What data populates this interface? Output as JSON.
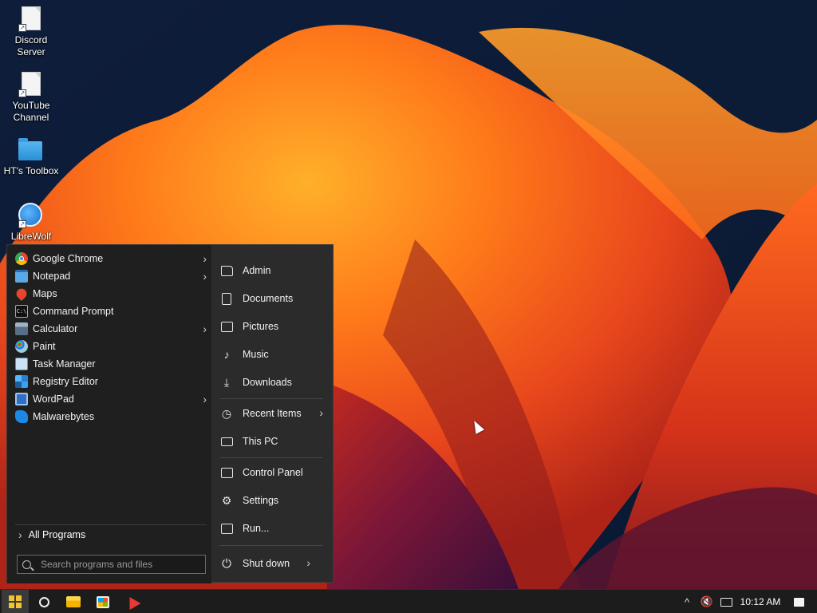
{
  "desktop": {
    "icons": [
      {
        "label_line1": "Discord",
        "label_line2": "Server",
        "icon": "text-file-shortcut-icon"
      },
      {
        "label_line1": "YouTube",
        "label_line2": "Channel",
        "icon": "text-file-shortcut-icon"
      },
      {
        "label_line1": "HT's Toolbox",
        "label_line2": "",
        "icon": "folder-icon"
      },
      {
        "label_line1": "LibreWolf",
        "label_line2": "",
        "icon": "librewolf-icon"
      }
    ]
  },
  "start_menu": {
    "programs": [
      {
        "label": "Google Chrome",
        "icon": "chrome-icon",
        "has_submenu": true
      },
      {
        "label": "Notepad",
        "icon": "notepad-icon",
        "has_submenu": true
      },
      {
        "label": "Maps",
        "icon": "maps-icon",
        "has_submenu": false
      },
      {
        "label": "Command Prompt",
        "icon": "command-prompt-icon",
        "has_submenu": false
      },
      {
        "label": "Calculator",
        "icon": "calculator-icon",
        "has_submenu": true
      },
      {
        "label": "Paint",
        "icon": "paint-icon",
        "has_submenu": false
      },
      {
        "label": "Task Manager",
        "icon": "task-manager-icon",
        "has_submenu": false
      },
      {
        "label": "Registry Editor",
        "icon": "registry-editor-icon",
        "has_submenu": false
      },
      {
        "label": "WordPad",
        "icon": "wordpad-icon",
        "has_submenu": true
      },
      {
        "label": "Malwarebytes",
        "icon": "malwarebytes-icon",
        "has_submenu": false
      }
    ],
    "all_programs_label": "All Programs",
    "search_placeholder": "Search programs and files",
    "places": [
      {
        "label": "Admin",
        "icon": "user-folder-icon"
      },
      {
        "label": "Documents",
        "icon": "documents-icon"
      },
      {
        "label": "Pictures",
        "icon": "pictures-icon"
      },
      {
        "label": "Music",
        "icon": "music-icon"
      },
      {
        "label": "Downloads",
        "icon": "downloads-icon"
      },
      {
        "label": "Recent Items",
        "icon": "recent-items-icon",
        "has_submenu": true
      },
      {
        "label": "This PC",
        "icon": "this-pc-icon"
      },
      {
        "label": "Control Panel",
        "icon": "control-panel-icon"
      },
      {
        "label": "Settings",
        "icon": "settings-icon"
      },
      {
        "label": "Run...",
        "icon": "run-icon"
      }
    ],
    "shutdown_label": "Shut down"
  },
  "taskbar": {
    "pinned": [
      "start-icon",
      "search-icon",
      "file-explorer-icon",
      "microsoft-store-icon",
      "app-icon"
    ],
    "tray": [
      "show-hidden-icons-icon",
      "volume-muted-icon",
      "network-icon",
      "notifications-icon"
    ],
    "clock": "10:12 AM"
  },
  "colors": {
    "menu_bg": "#2b2b2b",
    "programs_bg": "#1f1f1f",
    "taskbar_bg": "#1c1c1c",
    "windows_accent": "#f1c232"
  }
}
